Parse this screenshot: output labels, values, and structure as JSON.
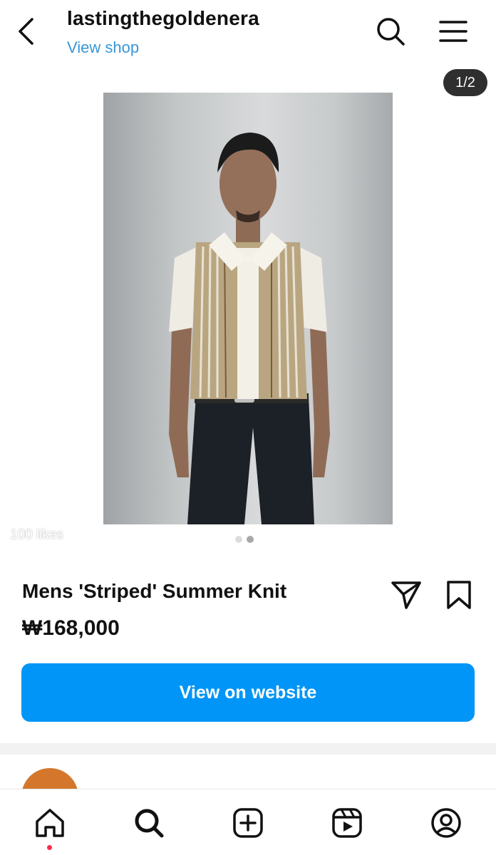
{
  "header": {
    "username": "lastingthegoldenera",
    "view_shop_label": "View shop",
    "icons": {
      "back": "chevron-left-icon",
      "search": "search-icon",
      "menu": "hamburger-menu-icon"
    }
  },
  "carousel": {
    "counter": "1/2",
    "current_index": 1,
    "total": 2,
    "likes_text": "100 likes"
  },
  "product": {
    "name": "Mens 'Striped' Summer Knit",
    "price": "₩168,000",
    "icons": {
      "share": "paper-plane-icon",
      "save": "bookmark-icon"
    }
  },
  "cta": {
    "label": "View on website",
    "color": "#0095f6"
  },
  "tabbar": {
    "items": [
      {
        "name": "home",
        "icon": "home-icon",
        "active": true,
        "notification_dot": true
      },
      {
        "name": "search",
        "icon": "search-icon"
      },
      {
        "name": "create",
        "icon": "plus-square-icon"
      },
      {
        "name": "reels",
        "icon": "reels-icon"
      },
      {
        "name": "profile",
        "icon": "profile-icon"
      }
    ],
    "dot_color": "#ff2a4d"
  },
  "colors": {
    "link": "#3897d6",
    "accent": "#0095f6",
    "avatar": "#d4772c"
  }
}
